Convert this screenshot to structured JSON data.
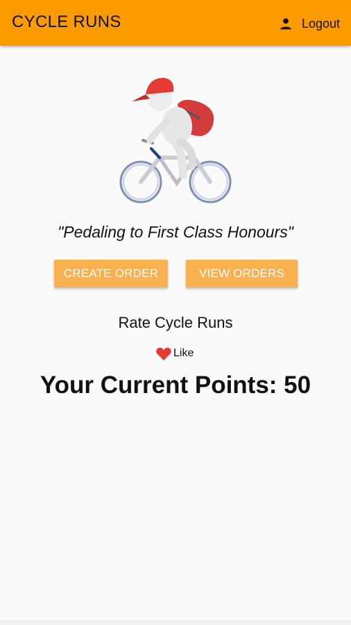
{
  "app_bar": {
    "title": "CYCLE RUNS",
    "logout_label": "Logout",
    "logout_icon": "person-icon",
    "background_color": "#fb9b00"
  },
  "hero": {
    "image": "cyclist-illustration"
  },
  "tagline": "\"Pedaling to First Class Honours\"",
  "actions": {
    "create_order_label": "CREATE ORDER",
    "view_orders_label": "VIEW ORDERS",
    "button_color": "#f9b04e"
  },
  "rating": {
    "label": "Rate Cycle Runs",
    "like_label": "Like",
    "like_icon": "heart-icon",
    "heart_color": "#e53935"
  },
  "points": {
    "text": "Your Current Points: 50"
  }
}
